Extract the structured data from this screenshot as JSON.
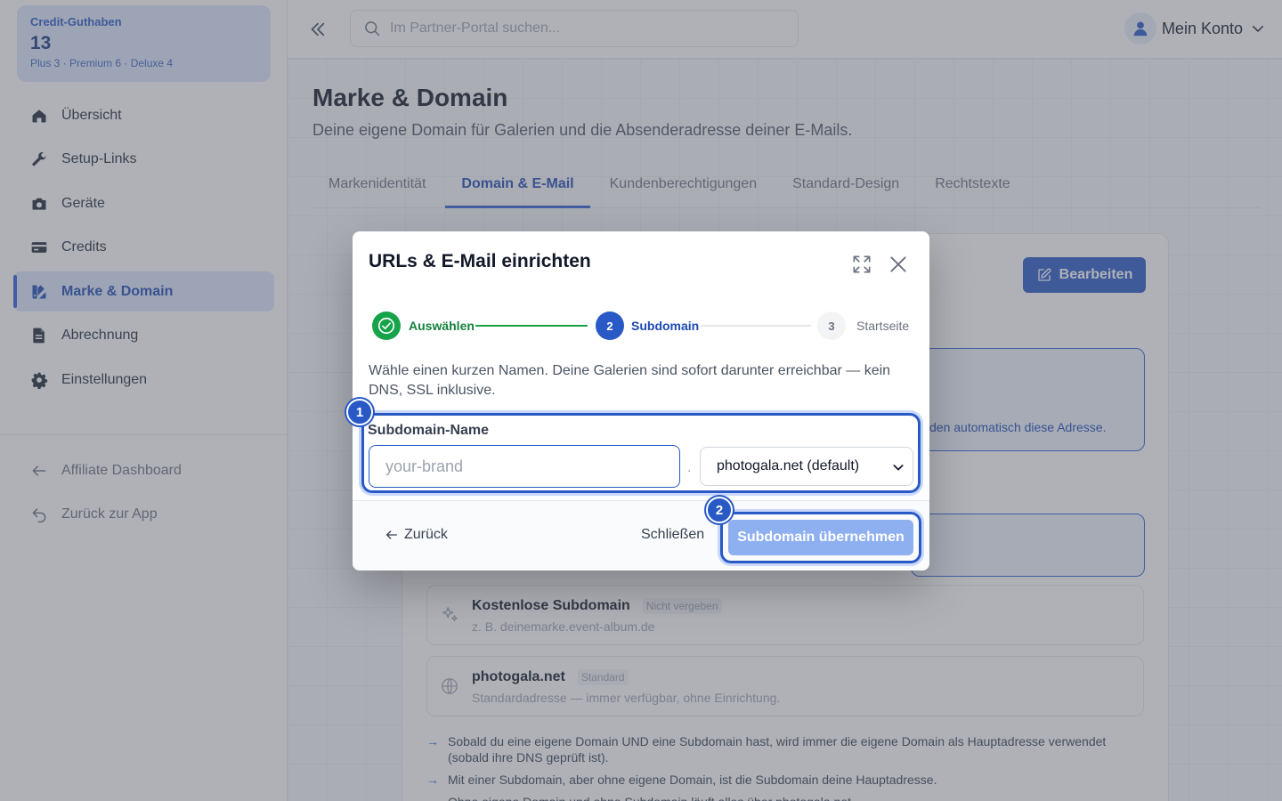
{
  "sidebar": {
    "credit": {
      "label": "Credit-Guthaben",
      "value": "13",
      "breakdown": "Plus 3 · Premium 6 · Deluxe 4"
    },
    "items": [
      {
        "label": "Übersicht",
        "icon": "home-icon"
      },
      {
        "label": "Setup-Links",
        "icon": "wrench-icon"
      },
      {
        "label": "Geräte",
        "icon": "camera-icon"
      },
      {
        "label": "Credits",
        "icon": "credit-card-icon"
      },
      {
        "label": "Marke & Domain",
        "icon": "brand-icon",
        "active": true
      },
      {
        "label": "Abrechnung",
        "icon": "document-icon"
      },
      {
        "label": "Einstellungen",
        "icon": "gear-icon"
      }
    ],
    "secondary": [
      {
        "label": "Affiliate Dashboard",
        "icon": "arrow-left-icon"
      },
      {
        "label": "Zurück zur App",
        "icon": "undo-icon"
      }
    ]
  },
  "topbar": {
    "search_placeholder": "Im Partner-Portal suchen...",
    "account_label": "Mein Konto"
  },
  "page": {
    "title": "Marke & Domain",
    "subtitle": "Deine eigene Domain für Galerien und die Absenderadresse deiner E-Mails.",
    "tabs": [
      {
        "label": "Markenidentität"
      },
      {
        "label": "Domain & E-Mail",
        "active": true
      },
      {
        "label": "Kundenberechtigungen"
      },
      {
        "label": "Standard-Design"
      },
      {
        "label": "Rechtstexte"
      }
    ],
    "edit_label": "Bearbeiten",
    "info_partial": "den automatisch diese Adresse.",
    "options": [
      {
        "title": "Kostenlose Subdomain",
        "badge": "Nicht vergeben",
        "desc": "z. B. deinemarke.event-album.de"
      },
      {
        "title": "photogala.net",
        "badge": "Standard",
        "desc": "Standardadresse — immer verfügbar, ohne Einrichtung."
      }
    ],
    "bullets": [
      "Sobald du eine eigene Domain UND eine Subdomain hast, wird immer die eigene Domain als Hauptadresse verwendet (sobald ihre DNS geprüft ist).",
      "Mit einer Subdomain, aber ohne eigene Domain, ist die Subdomain deine Hauptadresse.",
      "Ohne eigene Domain und ohne Subdomain läuft alles über photogala.net."
    ]
  },
  "modal": {
    "title": "URLs & E-Mail einrichten",
    "steps": [
      {
        "num": "1",
        "label": "Auswählen",
        "state": "done"
      },
      {
        "num": "2",
        "label": "Subdomain",
        "state": "active"
      },
      {
        "num": "3",
        "label": "Startseite",
        "state": "pending"
      }
    ],
    "description": "Wähle einen kurzen Namen. Deine Galerien sind sofort darunter erreichbar — kein DNS, SSL inklusive.",
    "field_label": "Subdomain-Name",
    "input_placeholder": "your-brand",
    "input_value": "",
    "separator": ".",
    "domain_selected": "photogala.net (default)",
    "back_label": "Zurück",
    "close_label": "Schließen",
    "apply_label": "Subdomain übernehmen",
    "badges": [
      "1",
      "2"
    ]
  },
  "colors": {
    "accent": "#2859c5",
    "success": "#16a34a",
    "apply_disabled": "#8eb0f1"
  }
}
